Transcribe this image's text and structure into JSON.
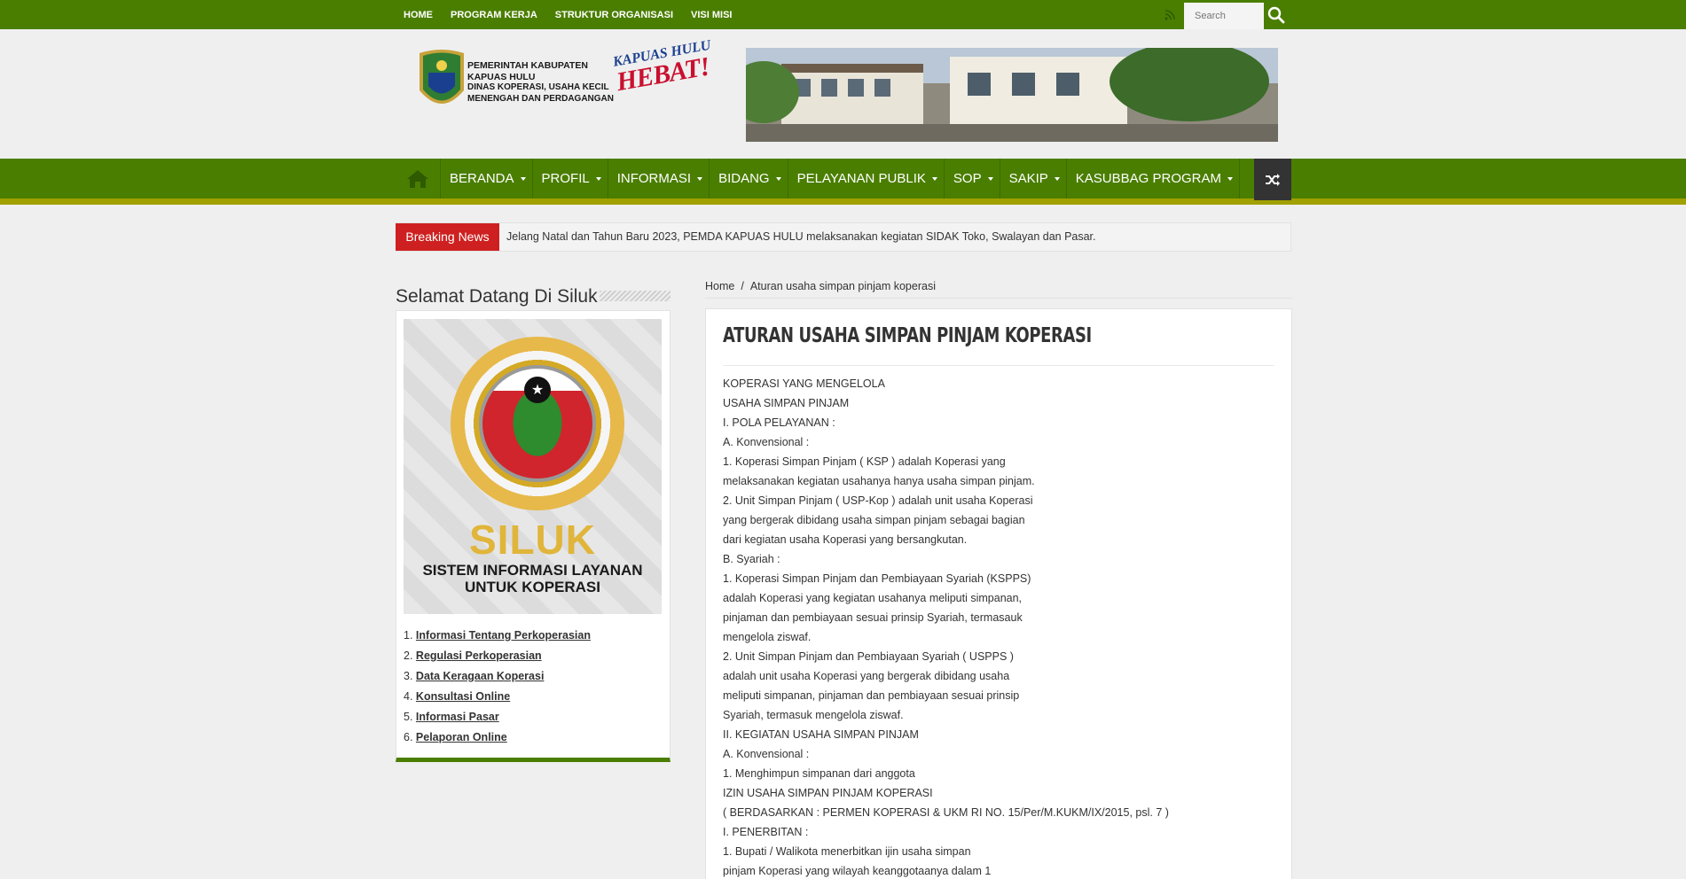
{
  "topbar": {
    "nav": [
      "HOME",
      "PROGRAM KERJA",
      "STRUKTUR ORGANISASI",
      "VISI MISI"
    ],
    "search_placeholder": "Search"
  },
  "header": {
    "logo_lines": [
      "PEMERINTAH KABUPATEN",
      "KAPUAS HULU",
      "DINAS KOPERASI, USAHA KECIL",
      "MENENGAH DAN PERDAGANGAN"
    ],
    "slogan_top": "KAPUAS HULU",
    "slogan_bottom": "HEBAT!"
  },
  "mainnav": {
    "items": [
      "BERANDA",
      "PROFIL",
      "INFORMASI",
      "BIDANG",
      "PELAYANAN PUBLIK",
      "SOP",
      "SAKIP",
      "KASUBBAG PROGRAM"
    ]
  },
  "breaking": {
    "label": "Breaking News",
    "text": "Jelang Natal dan Tahun Baru 2023, PEMDA KAPUAS HULU melaksanakan kegiatan SIDAK Toko, Swalayan dan Pasar."
  },
  "sidebar": {
    "title": "Selamat Datang Di Siluk",
    "logo_word": "SILUK",
    "logo_sub_1": "SISTEM INFORMASI LAYANAN",
    "logo_sub_2": "UNTUK KOPERASI",
    "links": [
      {
        "num": "1.",
        "label": "Informasi Tentang Perkoperasian"
      },
      {
        "num": "2.",
        "label": "Regulasi Perkoperasian"
      },
      {
        "num": "3.",
        "label": "Data Keragaan Koperasi"
      },
      {
        "num": "4.",
        "label": "Konsultasi Online"
      },
      {
        "num": "5.",
        "label": "Informasi Pasar"
      },
      {
        "num": "6.",
        "label": "Pelaporan Online"
      }
    ]
  },
  "breadcrumb": {
    "home": "Home",
    "sep": "/",
    "current": "Aturan usaha simpan pinjam koperasi"
  },
  "post": {
    "title": "ATURAN USAHA SIMPAN PINJAM KOPERASI",
    "lines": [
      "KOPERASI YANG MENGELOLA",
      "USAHA SIMPAN PINJAM",
      "I. POLA PELAYANAN :",
      "A. Konvensional :",
      "1. Koperasi Simpan Pinjam ( KSP ) adalah Koperasi yang",
      "melaksanakan kegiatan usahanya hanya usaha simpan pinjam.",
      "2. Unit Simpan Pinjam ( USP-Kop ) adalah unit usaha Koperasi",
      "yang bergerak dibidang usaha simpan pinjam sebagai bagian",
      "dari kegiatan usaha Koperasi yang bersangkutan.",
      "B. Syariah :",
      "1. Koperasi Simpan Pinjam dan Pembiayaan Syariah (KSPPS)",
      "adalah Koperasi yang kegiatan usahanya meliputi simpanan,",
      "pinjaman dan pembiayaan sesuai prinsip Syariah, termasauk",
      "mengelola ziswaf.",
      "2. Unit Simpan Pinjam dan Pembiayaan Syariah ( USPPS )",
      "adalah unit usaha Koperasi yang bergerak dibidang usaha",
      "meliputi simpanan, pinjaman dan pembiayaan sesuai prinsip",
      "Syariah, termasuk mengelola ziswaf.",
      "II. KEGIATAN USAHA SIMPAN PINJAM",
      "A. Konvensional :",
      "1. Menghimpun simpanan dari anggota",
      "IZIN USAHA SIMPAN PINJAM KOPERASI",
      "( BERDASARKAN : PERMEN KOPERASI & UKM RI NO. 15/Per/M.KUKM/IX/2015, psl. 7 )",
      "I. PENERBITAN :",
      "1. Bupati / Walikota menerbitkan ijin usaha simpan",
      "pinjam Koperasi yang wilayah keanggotaanya dalam 1"
    ]
  },
  "colors": {
    "primary_green": "#4a7e00",
    "breaking_red": "#ce2020",
    "stripe_olive": "#a0a000"
  },
  "icons": [
    "rss-icon",
    "search-icon",
    "home-icon",
    "shuffle-icon"
  ]
}
